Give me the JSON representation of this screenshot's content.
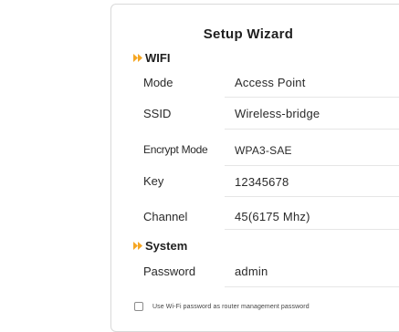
{
  "wizard": {
    "title": "Setup Wizard"
  },
  "wifi_section": {
    "heading": "WIFI",
    "rows": [
      {
        "label": "Mode",
        "value": "Access Point"
      },
      {
        "label": "SSID",
        "value": "Wireless-bridge"
      },
      {
        "label": "Encrypt Mode",
        "value": "WPA3-SAE"
      },
      {
        "label": "Key",
        "value": "12345678"
      },
      {
        "label": "Channel",
        "value": "45(6175 Mhz)"
      }
    ]
  },
  "system_section": {
    "heading": "System",
    "rows": [
      {
        "label": "Password",
        "value": "admin"
      }
    ]
  },
  "options": {
    "use_wifi_password_label": "Use Wi-Fi password as router management password",
    "use_wifi_password_checked": false
  },
  "colors": {
    "accent": "#f5a623",
    "text": "#222222",
    "border": "#d9d9d9"
  },
  "icons": {
    "section_marker": "double-chevron-right-icon"
  }
}
